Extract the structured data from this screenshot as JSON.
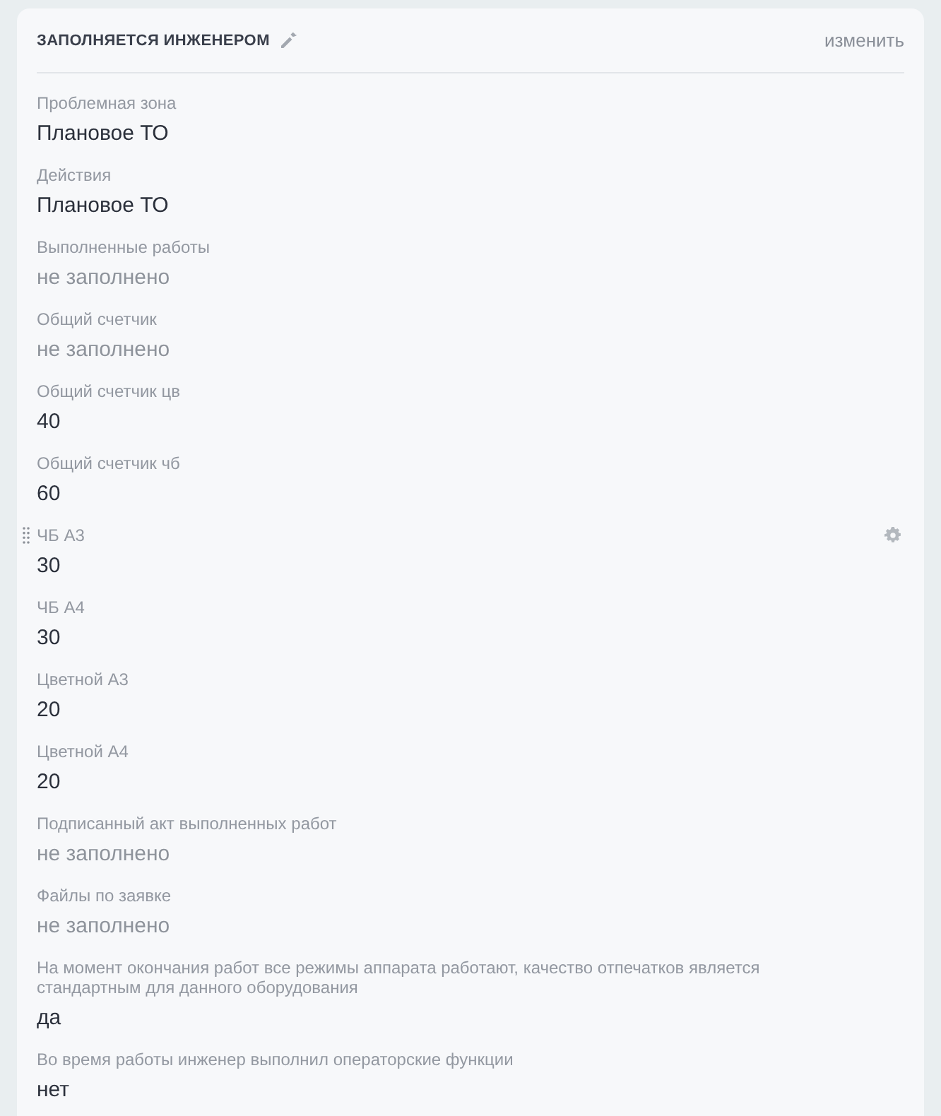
{
  "section": {
    "title": "ЗАПОЛНЯЕТСЯ ИНЖЕНЕРОМ",
    "edit_link": "изменить"
  },
  "fields": [
    {
      "label": "Проблемная зона",
      "value": "Плановое ТО",
      "filled": true,
      "hovered": false
    },
    {
      "label": "Действия",
      "value": "Плановое ТО",
      "filled": true,
      "hovered": false
    },
    {
      "label": "Выполненные работы",
      "value": "не заполнено",
      "filled": false,
      "hovered": false
    },
    {
      "label": "Общий счетчик",
      "value": "не заполнено",
      "filled": false,
      "hovered": false
    },
    {
      "label": "Общий счетчик цв",
      "value": "40",
      "filled": true,
      "hovered": false
    },
    {
      "label": "Общий счетчик чб",
      "value": "60",
      "filled": true,
      "hovered": false
    },
    {
      "label": "ЧБ А3",
      "value": "30",
      "filled": true,
      "hovered": true
    },
    {
      "label": "ЧБ А4",
      "value": "30",
      "filled": true,
      "hovered": false
    },
    {
      "label": "Цветной А3",
      "value": "20",
      "filled": true,
      "hovered": false
    },
    {
      "label": "Цветной А4",
      "value": "20",
      "filled": true,
      "hovered": false
    },
    {
      "label": "Подписанный акт выполненных работ",
      "value": "не заполнено",
      "filled": false,
      "hovered": false
    },
    {
      "label": "Файлы по заявке",
      "value": "не заполнено",
      "filled": false,
      "hovered": false
    },
    {
      "label": "На момент окончания работ все режимы аппарата работают, качество отпечатков является стандартным для данного оборудования",
      "value": "да",
      "filled": true,
      "hovered": false
    },
    {
      "label": "Во время работы инженер выполнил операторские функции",
      "value": "нет",
      "filled": true,
      "hovered": false
    }
  ]
}
